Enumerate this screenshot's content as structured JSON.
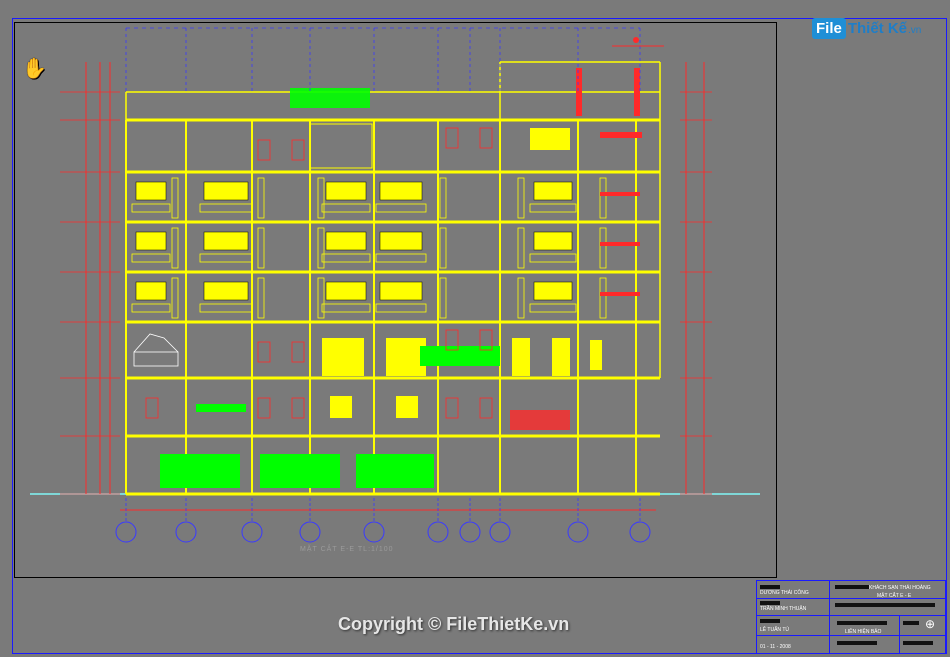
{
  "brand": {
    "file": "File",
    "rest": "Thiết Kế",
    "suffix": ".vn"
  },
  "drawing": {
    "section_caption": "MẶT CẮT E-E TL:1/100"
  },
  "title_block": {
    "designer_1": "DƯƠNG THÁI CÔNG",
    "designer_2": "TRẦN MINH THUẬN",
    "checker": "LÊ TUẤN TÚ",
    "date": "01 - 11 - 2008",
    "project": "KHÁCH SẠN THÁI HOÀNG",
    "sheet_title": "MẶT CẮT E - E",
    "owner": "LIÊN HIỆN BẢO"
  },
  "watermark": "Copyright © FileThietKe.vn",
  "colors": {
    "background": "#7a7a7a",
    "frame": "#1a1aff",
    "structure": "#ffff00",
    "dimension": "#ff2a2a",
    "hatch": "#00ff00",
    "grid_bubble": "#3a3aff",
    "ground": "#7fd7d7"
  },
  "icons": {
    "cursor": "pan-hand-icon"
  }
}
